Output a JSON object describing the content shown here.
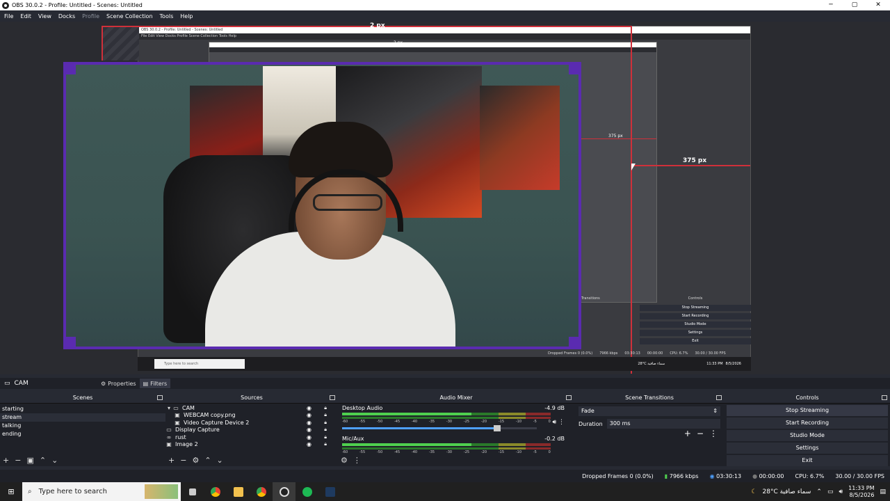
{
  "window": {
    "title": "OBS 30.0.2 - Profile: Untitled - Scenes: Untitled",
    "min": "─",
    "max": "▢",
    "close": "✕"
  },
  "menu": [
    "File",
    "Edit",
    "View",
    "Docks",
    "Profile",
    "Scene Collection",
    "Tools",
    "Help"
  ],
  "preview": {
    "label_top": "2 px",
    "label_top_small": "2 px",
    "label_right": "375 px",
    "label_right_small": "375 px",
    "nested_title": "OBS 30.0.2 - Profile: Untitled - Scenes: Untitled",
    "nested_menu": "File  Edit  View  Docks  Profile  Scene Collection  Tools  Help",
    "nested_search": "Type here to search",
    "nested_status": [
      "Dropped Frames 0 (0.0%)",
      "7966 kbps",
      "03:30:13",
      "00:00:00",
      "CPU: 6.7%",
      "30.00 / 30.00 FPS"
    ],
    "nested_controls": [
      "Controls",
      "Stop Streaming",
      "Start Recording",
      "Studio Mode",
      "Settings",
      "Exit"
    ],
    "nested_transitions": "Transitions",
    "nested_weather": "28°C  سماء صافية",
    "nested_clock": [
      "11:33 PM",
      "8/5/2026"
    ]
  },
  "source_bar": {
    "scene": "CAM",
    "properties": "Properties",
    "filters": "Filters"
  },
  "scenes": {
    "title": "Scenes",
    "items": [
      "starting",
      "stream",
      "talking",
      "ending"
    ],
    "selected": 1
  },
  "sources": {
    "title": "Sources",
    "items": [
      {
        "name": "CAM",
        "indent": 0,
        "icon": "folder",
        "expand": "▾"
      },
      {
        "name": "WEBCAM copy.png",
        "indent": 1,
        "icon": "image"
      },
      {
        "name": "Video Capture Device 2",
        "indent": 1,
        "icon": "camera"
      },
      {
        "name": "Display Capture",
        "indent": 0,
        "icon": "monitor"
      },
      {
        "name": "rust",
        "indent": 0,
        "icon": "link"
      },
      {
        "name": "Image 2",
        "indent": 0,
        "icon": "image"
      }
    ]
  },
  "mixer": {
    "title": "Audio Mixer",
    "channels": [
      {
        "name": "Desktop Audio",
        "db": "-4.9 dB",
        "level": 0.62
      },
      {
        "name": "Mic/Aux",
        "db": "-0.2 dB",
        "level": 0.6
      }
    ],
    "scale": [
      "-60",
      "-55",
      "-50",
      "-45",
      "-40",
      "-35",
      "-30",
      "-25",
      "-20",
      "-15",
      "-10",
      "-5",
      "0"
    ]
  },
  "transitions": {
    "title": "Scene Transitions",
    "type": "Fade",
    "duration_label": "Duration",
    "duration": "300 ms"
  },
  "controls": {
    "title": "Controls",
    "buttons": [
      "Stop Streaming",
      "Start Recording",
      "Studio Mode",
      "Settings",
      "Exit"
    ]
  },
  "status": {
    "dropped": "Dropped Frames 0 (0.0%)",
    "kbps": "7966 kbps",
    "stream_time": "03:30:13",
    "rec_time": "00:00:00",
    "cpu": "CPU: 6.7%",
    "fps": "30.00 / 30.00 FPS"
  },
  "taskbar": {
    "search": "Type here to search",
    "weather": "28°C  سماء صافية",
    "time": "11:33 PM",
    "date": "8/5/2026"
  }
}
